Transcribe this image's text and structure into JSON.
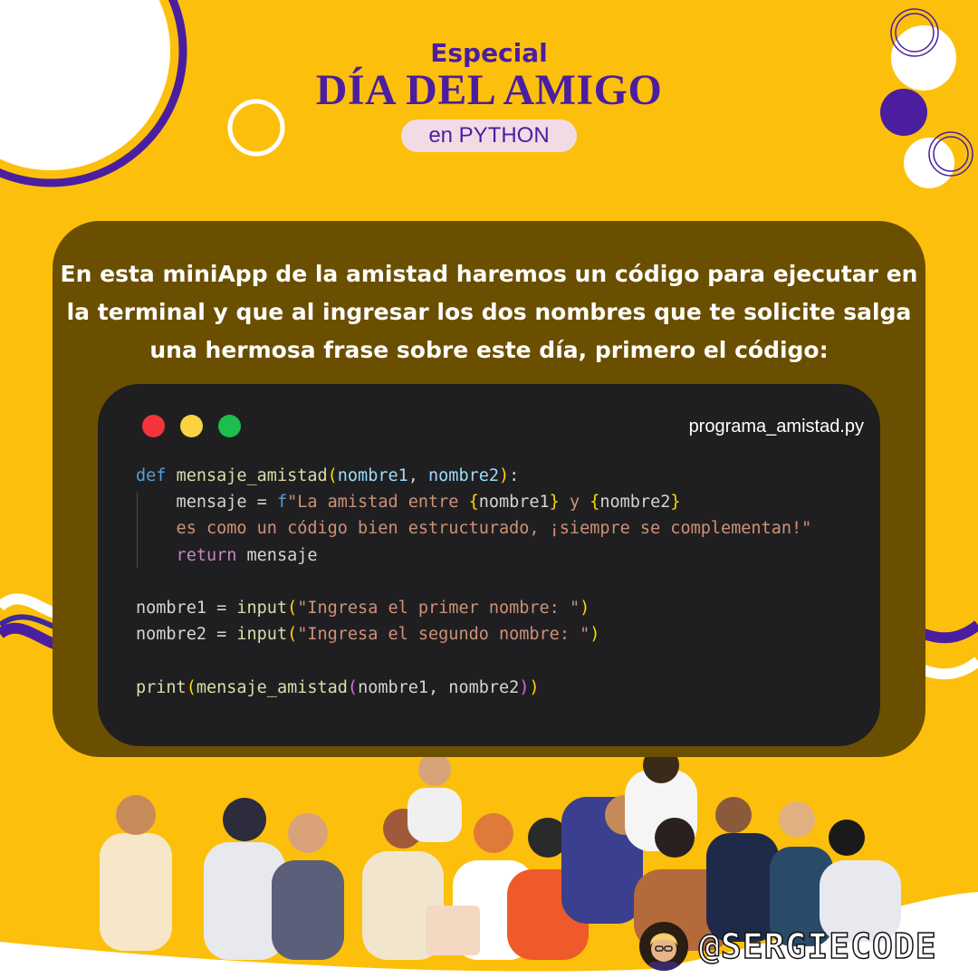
{
  "header": {
    "subtitle": "Especial",
    "title": "DÍA DEL AMIGO",
    "pill": "en PYTHON"
  },
  "intro_text": "En esta miniApp de la amistad haremos un código para ejecutar en la terminal y que al ingresar los dos nombres que te solicite salga una hermosa frase sobre este día, primero el código:",
  "code_window": {
    "filename": "programa_amistad.py",
    "window_buttons": [
      "close",
      "minimize",
      "maximize"
    ],
    "lines": [
      {
        "seg": [
          [
            "kw",
            "def "
          ],
          [
            "fn",
            "mensaje_amistad"
          ],
          [
            "br",
            "("
          ],
          [
            "pm",
            "nombre1"
          ],
          [
            "var",
            ", "
          ],
          [
            "pm",
            "nombre2"
          ],
          [
            "br",
            ")"
          ],
          [
            "var",
            ":"
          ]
        ]
      },
      {
        "seg": [
          [
            "var",
            "    mensaje = "
          ],
          [
            "kw",
            "f"
          ],
          [
            "st",
            "\"La amistad entre "
          ],
          [
            "br",
            "{"
          ],
          [
            "var",
            "nombre1"
          ],
          [
            "br",
            "}"
          ],
          [
            "st",
            " y "
          ],
          [
            "br",
            "{"
          ],
          [
            "var",
            "nombre2"
          ],
          [
            "br",
            "}"
          ]
        ]
      },
      {
        "seg": [
          [
            "st",
            "    es como un código bien estructurado, ¡siempre se complementan!\""
          ]
        ]
      },
      {
        "seg": [
          [
            "ctl",
            "    return "
          ],
          [
            "var",
            "mensaje"
          ]
        ]
      },
      {
        "seg": [
          [
            "var",
            ""
          ]
        ]
      },
      {
        "seg": [
          [
            "var",
            "nombre1 = "
          ],
          [
            "fn",
            "input"
          ],
          [
            "br",
            "("
          ],
          [
            "st",
            "\"Ingresa el primer nombre: \""
          ],
          [
            "br",
            ")"
          ]
        ]
      },
      {
        "seg": [
          [
            "var",
            "nombre2 = "
          ],
          [
            "fn",
            "input"
          ],
          [
            "br",
            "("
          ],
          [
            "st",
            "\"Ingresa el segundo nombre: \""
          ],
          [
            "br",
            ")"
          ]
        ]
      },
      {
        "seg": [
          [
            "var",
            ""
          ]
        ]
      },
      {
        "seg": [
          [
            "fn",
            "print"
          ],
          [
            "br",
            "("
          ],
          [
            "fn",
            "mensaje_amistad"
          ],
          [
            "br2",
            "("
          ],
          [
            "var",
            "nombre1, nombre2"
          ],
          [
            "br2",
            ")"
          ],
          [
            "br",
            ")"
          ]
        ]
      }
    ]
  },
  "brand": {
    "handle": "@SERGIECODE"
  },
  "colors": {
    "background": "#fcc00c",
    "purple": "#4b1ea0",
    "panel": "#6b4f00",
    "code_bg": "#1f1f21"
  }
}
